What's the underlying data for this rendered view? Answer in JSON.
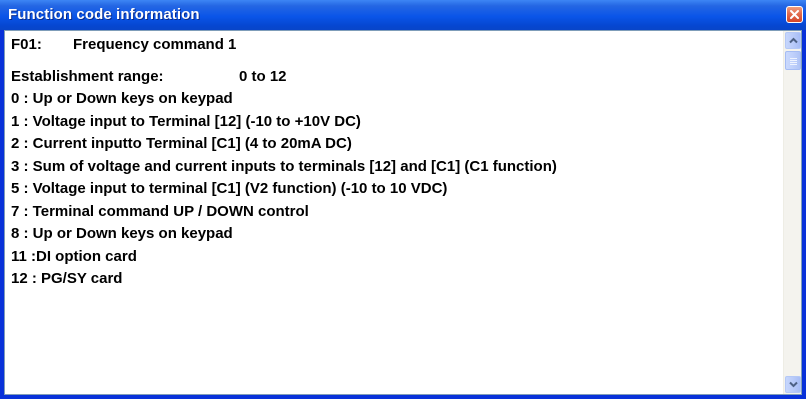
{
  "window": {
    "title": "Function code information"
  },
  "code": {
    "id": "F01:",
    "name": "Frequency command 1"
  },
  "range": {
    "label": "Establishment range:",
    "value": "0 to 12"
  },
  "options": [
    "0 : Up or Down keys on keypad",
    "1 : Voltage input to Terminal [12] (-10 to +10V DC)",
    "2 : Current inputto Terminal [C1] (4 to 20mA DC)",
    "3 : Sum of voltage and current inputs to terminals [12] and [C1] (C1 function)",
    "5 : Voltage input to terminal [C1] (V2 function) (-10 to 10 VDC)",
    "7 : Terminal command UP / DOWN control",
    "8 : Up or Down keys on keypad",
    "11 :DI option card",
    "12 : PG/SY card"
  ],
  "colors": {
    "titlebar": "#0a55e8",
    "close_button": "#e26c4d",
    "scrollbar_button": "#b9cbf9"
  },
  "icons": {
    "close": "close-icon",
    "scroll_up": "chevron-up-icon",
    "scroll_down": "chevron-down-icon"
  }
}
